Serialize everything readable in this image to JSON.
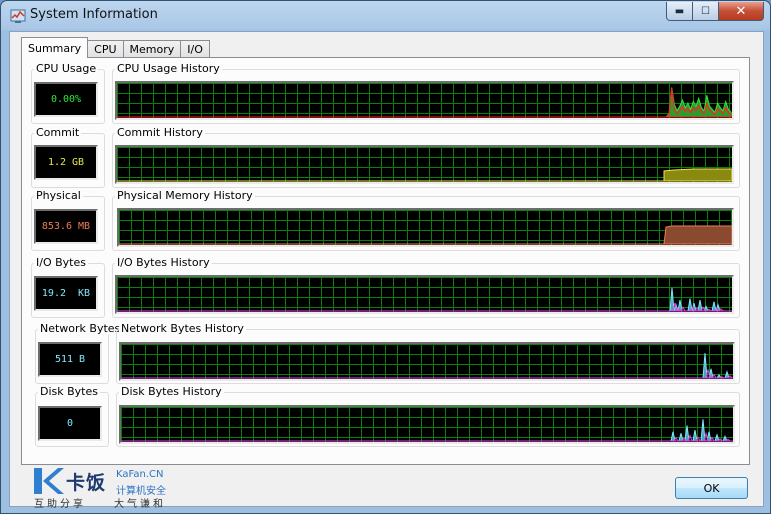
{
  "window": {
    "title": "System Information",
    "close_glyph": "✕",
    "min_glyph": "▬",
    "max_glyph": "☐",
    "icon": "system-information-icon"
  },
  "tabs": [
    {
      "label": "Summary",
      "active": true
    },
    {
      "label": "CPU",
      "active": false
    },
    {
      "label": "Memory",
      "active": false
    },
    {
      "label": "I/O",
      "active": false
    }
  ],
  "meters": {
    "cpu": {
      "label": "CPU Usage",
      "value": "0.00%",
      "color": "#2be83b"
    },
    "commit": {
      "label": "Commit",
      "value": "1.2 GB",
      "color": "#e8e84a"
    },
    "physical": {
      "label": "Physical",
      "value": "853.6 MB",
      "color": "#f07a5a"
    },
    "io": {
      "label": "I/O Bytes",
      "value": "19.2  KB",
      "color": "#7fe8ff"
    },
    "network": {
      "label": "Network Bytes",
      "value": "511 B",
      "color": "#7fe8ff"
    },
    "disk": {
      "label": "Disk Bytes",
      "value": "0",
      "color": "#7fe8ff"
    }
  },
  "histories": {
    "cpu": {
      "label": "CPU Usage History"
    },
    "commit": {
      "label": "Commit History"
    },
    "physical": {
      "label": "Physical Memory History"
    },
    "io": {
      "label": "I/O Bytes History"
    },
    "network": {
      "label": "Network Bytes History"
    },
    "disk": {
      "label": "Disk Bytes History"
    }
  },
  "ok_label": "OK",
  "watermark": {
    "cn": "卡饭",
    "en": "KaFan.CN",
    "sub": "计算机安全",
    "line1": "互助分享",
    "line2": "大气谦和"
  }
}
